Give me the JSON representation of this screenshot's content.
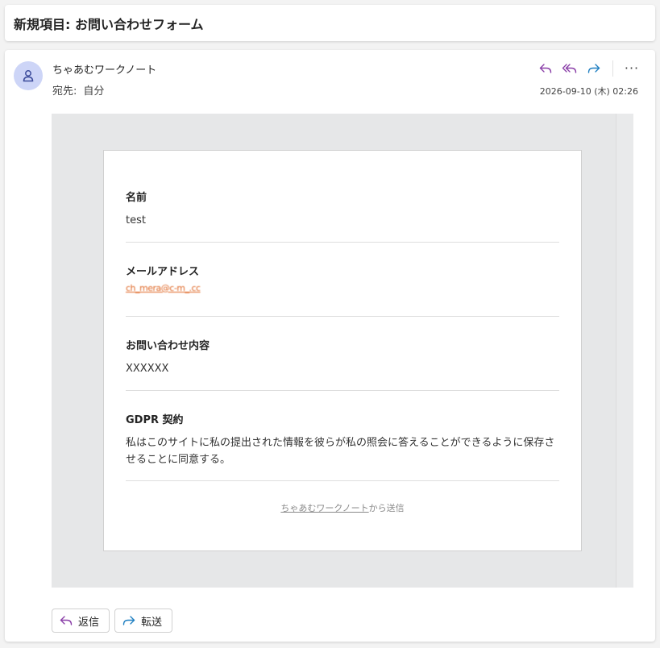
{
  "subject": "新規項目: お問い合わせフォーム",
  "header": {
    "sender": "ちゃあむワークノート",
    "to_label": "宛先:",
    "to_value": "自分",
    "datetime": "2026-09-10 (木) 02:26",
    "actions": [
      "reply-icon",
      "reply-all-icon",
      "forward-icon",
      "more-icon"
    ],
    "more_label": "···"
  },
  "form": {
    "fields": [
      {
        "label": "名前",
        "value": "test"
      },
      {
        "label": "メールアドレス",
        "value": "ch_mera@c-m_.cc"
      },
      {
        "label": "お問い合わせ内容",
        "value": "XXXXXX"
      },
      {
        "label": "GDPR 契約",
        "value": "私はこのサイトに私の提出された情報を彼らが私の照会に答えることができるように保存させることに同意する。"
      }
    ],
    "footer_link": "ちゃあむワークノート",
    "footer_suffix": "から送信"
  },
  "buttons": {
    "reply": "返信",
    "forward": "転送"
  },
  "colors": {
    "avatar_bg": "#cdd5f7",
    "reply_icon": "#8a3fa8",
    "forward_icon": "#1f7fc1"
  }
}
